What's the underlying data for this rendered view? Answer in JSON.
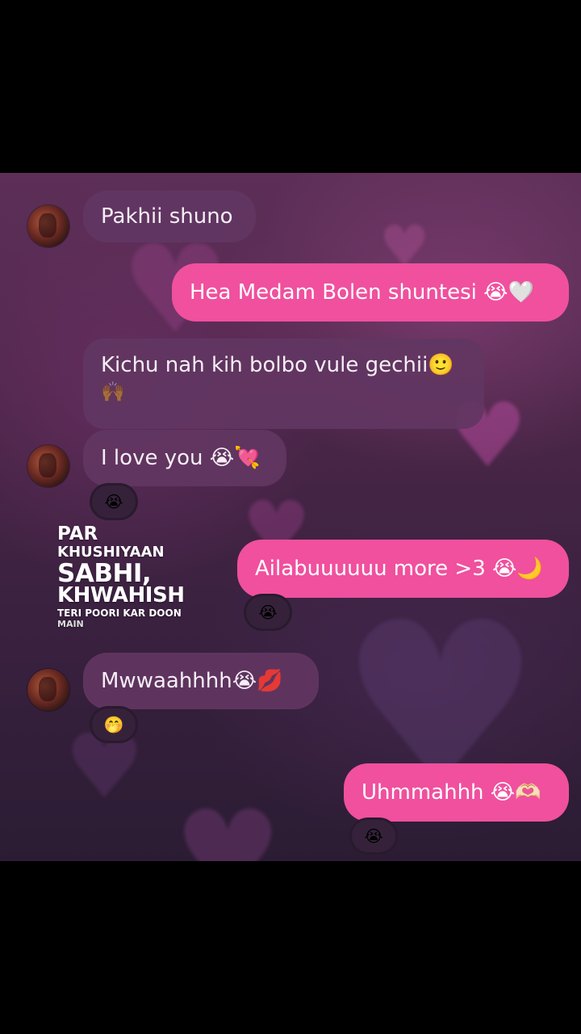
{
  "messages": [
    {
      "id": "m1",
      "side": "incoming",
      "text": "Pakhii shuno"
    },
    {
      "id": "m2",
      "side": "outgoing",
      "text": "Hea Medam Bolen shuntesi 😭🤍"
    },
    {
      "id": "m3",
      "side": "incoming",
      "text": "Kichu nah kih bolbo vule gechii🙂",
      "text2": "🙌🏾"
    },
    {
      "id": "m4",
      "side": "incoming",
      "text": "I love you 😭💘",
      "reaction": "😭"
    },
    {
      "id": "m5",
      "side": "outgoing",
      "text": "Ailabuuuuuu more >3 😭🌙",
      "reaction": "😭"
    },
    {
      "id": "m6",
      "side": "incoming",
      "text": "Mwwaahhhh😭💋",
      "reaction": "🤭"
    },
    {
      "id": "m7",
      "side": "outgoing",
      "text": "Uhmmahhh 😭🫶🏻",
      "reaction": "😭"
    }
  ],
  "overlay_caption": {
    "line1": "PAR",
    "line2": "KHUSHIYAAN",
    "line3": "SABHI,",
    "line4": "KHWAHISH",
    "line5": "TERI POORI KAR DOON",
    "line6": "MAIN"
  },
  "colors": {
    "incoming_bubble": "#62366a",
    "outgoing_bubble": "#f0509e",
    "background": "#000000"
  }
}
